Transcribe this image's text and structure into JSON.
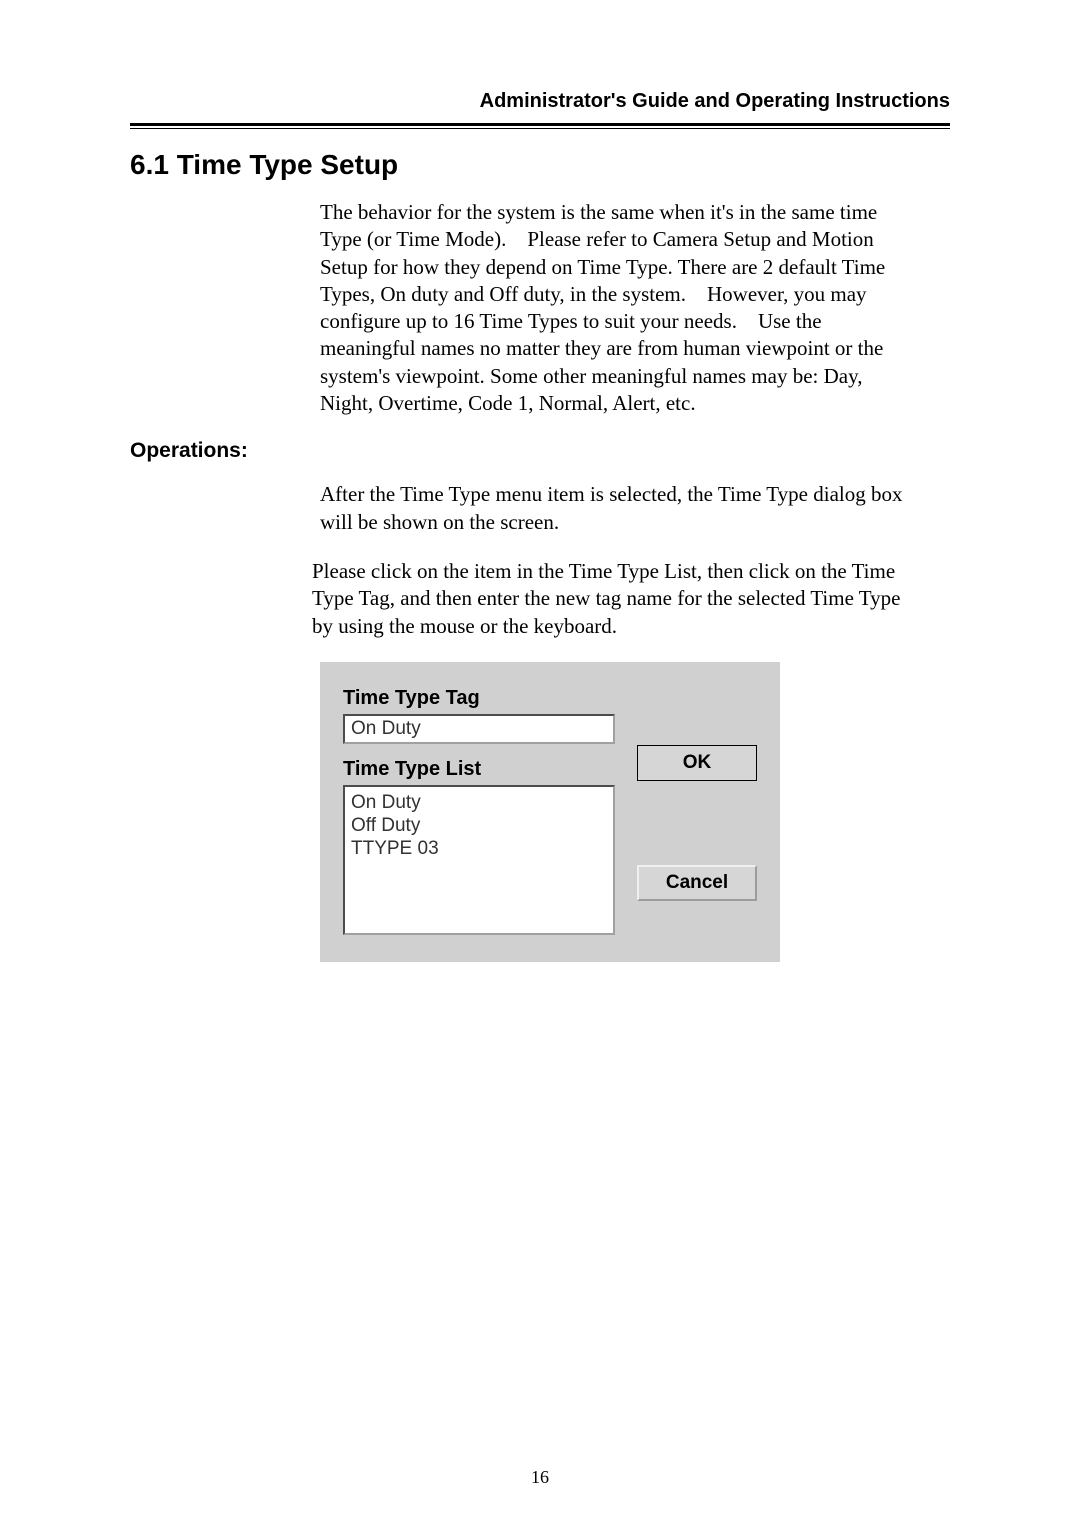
{
  "header": {
    "title": "Administrator's Guide and Operating Instructions"
  },
  "section": {
    "title": "6.1 Time Type Setup"
  },
  "body": {
    "para1": "The behavior for the system is the same when it's in the same time Type (or Time Mode). Please refer to Camera Setup and Motion Setup for how they depend on Time Type. There are 2 default Time Types, On duty and Off duty, in the system. However, you may configure up to 16 Time Types to suit your needs. Use the meaningful names no matter they are from human viewpoint or the system's viewpoint. Some other meaningful names may be: Day, Night, Overtime, Code 1, Normal, Alert, etc.",
    "operations_label": "Operations:",
    "para2": "After the Time Type menu item is selected, the Time Type dialog box will be shown on the screen.",
    "para3": "Please click on the item in the Time Type List, then click on the Time Type Tag, and then enter the new tag name for the selected Time Type by using the mouse or the keyboard."
  },
  "dialog": {
    "tag_label": "Time Type Tag",
    "tag_value": "On Duty",
    "list_label": "Time Type List",
    "list_items": [
      "On Duty",
      "Off Duty",
      "TTYPE 03"
    ],
    "ok_label": "OK",
    "cancel_label": "Cancel"
  },
  "page_number": "16"
}
